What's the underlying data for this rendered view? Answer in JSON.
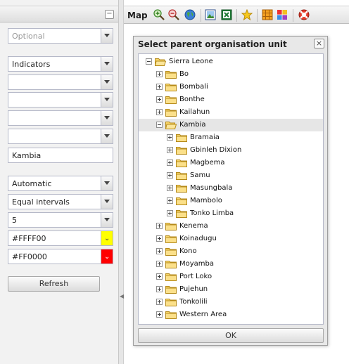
{
  "left_panel": {
    "fields": [
      {
        "value": "Optional",
        "placeholder": true
      },
      {
        "value": "Indicators"
      },
      {
        "value": ""
      },
      {
        "value": ""
      },
      {
        "value": ""
      },
      {
        "value": ""
      }
    ],
    "org_unit_text": "Kambia",
    "method": "Automatic",
    "classification": "Equal intervals",
    "classes": "5",
    "color_low": "#FFFF00",
    "color_high": "#FF0000",
    "refresh_label": "Refresh"
  },
  "colors": {
    "swatch_low": "#FFFF00",
    "swatch_high": "#FF0000"
  },
  "toolbar": {
    "title": "Map",
    "icons": [
      "zoom-in-icon",
      "zoom-out-icon",
      "globe-icon",
      "export-image-icon",
      "export-excel-icon",
      "favorite-star-icon",
      "grid-legend-icon",
      "color-grid-icon",
      "help-lifebuoy-icon"
    ]
  },
  "dialog": {
    "title": "Select parent organisation unit",
    "ok_label": "OK",
    "tree": {
      "root": "Sierra Leone",
      "districts": [
        "Bo",
        "Bombali",
        "Bonthe",
        "Kailahun",
        "Kambia",
        "Kenema",
        "Koinadugu",
        "Kono",
        "Moyamba",
        "Port Loko",
        "Pujehun",
        "Tonkolili",
        "Western Area"
      ],
      "kambia_chiefdoms": [
        "Bramaia",
        "Gbinleh Dixion",
        "Magbema",
        "Samu",
        "Masungbala",
        "Mambolo",
        "Tonko Limba"
      ]
    }
  }
}
